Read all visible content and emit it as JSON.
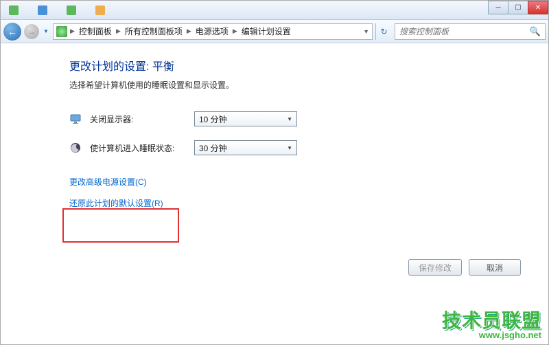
{
  "titlebar": {
    "tabs": [
      {
        "label": ""
      },
      {
        "label": ""
      },
      {
        "label": ""
      },
      {
        "label": ""
      }
    ]
  },
  "nav": {
    "breadcrumbs": [
      "控制面板",
      "所有控制面板项",
      "电源选项",
      "编辑计划设置"
    ],
    "search_placeholder": "搜索控制面板"
  },
  "page": {
    "title": "更改计划的设置: 平衡",
    "subtitle": "选择希望计算机使用的睡眠设置和显示设置。",
    "settings": [
      {
        "label": "关闭显示器:",
        "value": "10 分钟"
      },
      {
        "label": "使计算机进入睡眠状态:",
        "value": "30 分钟"
      }
    ],
    "link_advanced": "更改高级电源设置(C)",
    "link_restore": "还原此计划的默认设置(R)",
    "btn_save": "保存修改",
    "btn_cancel": "取消"
  },
  "watermark": {
    "text": "技术员联盟",
    "url": "www.jsgho.net"
  }
}
